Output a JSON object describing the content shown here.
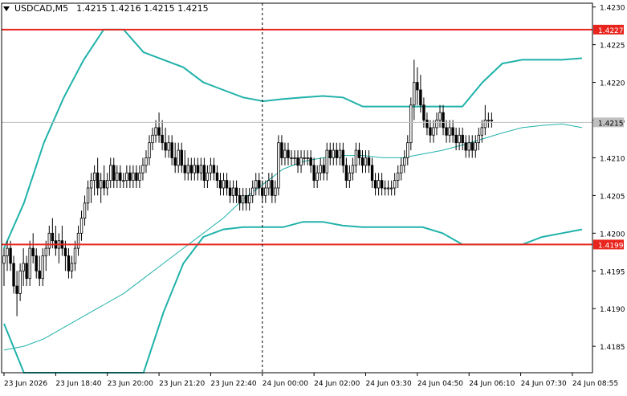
{
  "header": {
    "symbol": "USDCAD,M5",
    "ohlc": "1.4215 1.4216 1.4215 1.4215"
  },
  "colors": {
    "background": "#ffffff",
    "candle": "#000000",
    "bands": "#20b2aa",
    "ma": "#20b2aa",
    "level_line": "#e8241c",
    "current_price_bg": "#c0c0c0",
    "grid": "#000000"
  },
  "chart_data": {
    "type": "candlestick",
    "symbol": "USDCAD",
    "timeframe": "M5",
    "ylim": [
      1.41815,
      1.42305
    ],
    "y_ticks": [
      "1.4230",
      "1.4225",
      "1.4220",
      "1.4215",
      "1.4210",
      "1.4205",
      "1.4200",
      "1.4195",
      "1.4190",
      "1.4185"
    ],
    "y_tick_values": [
      1.423,
      1.4225,
      1.422,
      1.4215,
      1.421,
      1.4205,
      1.42,
      1.4195,
      1.419,
      1.4185
    ],
    "x_ticks": [
      "23 Jun 2026",
      "23 Jun 18:40",
      "23 Jun 20:00",
      "23 Jun 21:20",
      "23 Jun 22:40",
      "24 Jun 00:00",
      "24 Jun 02:00",
      "24 Jun 03:30",
      "24 Jun 04:50",
      "24 Jun 06:10",
      "24 Jun 07:30",
      "24 Jun 08:55"
    ],
    "x_tick_index": [
      0,
      16,
      32,
      48,
      64,
      80,
      96,
      112,
      128,
      144,
      160,
      176
    ],
    "period_separator_index": 80,
    "levels": [
      {
        "label": "1.4227",
        "value": 1.4227
      },
      {
        "label": "1.4199",
        "value": 1.41985
      }
    ],
    "current_price": {
      "label": "1.4215",
      "value": 1.42147
    },
    "grid": false,
    "candles": [
      [
        1.4196,
        1.4198,
        1.4193,
        1.4197
      ],
      [
        1.4197,
        1.4199,
        1.4195,
        1.4198
      ],
      [
        1.4198,
        1.4199,
        1.4195,
        1.4196
      ],
      [
        1.4196,
        1.4197,
        1.4192,
        1.4193
      ],
      [
        1.4193,
        1.4195,
        1.4189,
        1.4192
      ],
      [
        1.4192,
        1.4196,
        1.4191,
        1.4195
      ],
      [
        1.4195,
        1.4198,
        1.4193,
        1.4196
      ],
      [
        1.4196,
        1.4197,
        1.4193,
        1.4194
      ],
      [
        1.4194,
        1.4199,
        1.4193,
        1.4198
      ],
      [
        1.4198,
        1.42,
        1.4196,
        1.4197
      ],
      [
        1.4197,
        1.4198,
        1.4194,
        1.4195
      ],
      [
        1.4195,
        1.4197,
        1.4193,
        1.4194
      ],
      [
        1.4194,
        1.4198,
        1.4193,
        1.4197
      ],
      [
        1.4197,
        1.4199,
        1.4195,
        1.4198
      ],
      [
        1.4198,
        1.4201,
        1.4197,
        1.42
      ],
      [
        1.42,
        1.4202,
        1.4198,
        1.4199
      ],
      [
        1.4199,
        1.4201,
        1.4197,
        1.4198
      ],
      [
        1.4198,
        1.42,
        1.4196,
        1.4199
      ],
      [
        1.4199,
        1.4201,
        1.4197,
        1.4198
      ],
      [
        1.4198,
        1.4199,
        1.4195,
        1.4197
      ],
      [
        1.4197,
        1.4198,
        1.4194,
        1.4195
      ],
      [
        1.4195,
        1.4197,
        1.4194,
        1.4196
      ],
      [
        1.4196,
        1.4199,
        1.4195,
        1.4198
      ],
      [
        1.4198,
        1.4201,
        1.4197,
        1.42
      ],
      [
        1.42,
        1.4203,
        1.4199,
        1.4202
      ],
      [
        1.4202,
        1.4205,
        1.4201,
        1.4204
      ],
      [
        1.4204,
        1.4207,
        1.4203,
        1.4206
      ],
      [
        1.4206,
        1.4208,
        1.4204,
        1.4207
      ],
      [
        1.4207,
        1.4209,
        1.4205,
        1.4208
      ],
      [
        1.4208,
        1.421,
        1.4205,
        1.4206
      ],
      [
        1.4206,
        1.4208,
        1.4204,
        1.4207
      ],
      [
        1.4207,
        1.4209,
        1.4205,
        1.4206
      ],
      [
        1.4206,
        1.4208,
        1.4205,
        1.4207
      ],
      [
        1.4207,
        1.421,
        1.4206,
        1.4209
      ],
      [
        1.4209,
        1.421,
        1.4206,
        1.4207
      ],
      [
        1.4207,
        1.4209,
        1.4206,
        1.4208
      ],
      [
        1.4208,
        1.4209,
        1.4206,
        1.4207
      ],
      [
        1.4207,
        1.4208,
        1.4206,
        1.4207
      ],
      [
        1.4207,
        1.4209,
        1.4206,
        1.4208
      ],
      [
        1.4208,
        1.4209,
        1.4206,
        1.4207
      ],
      [
        1.4207,
        1.4209,
        1.4206,
        1.4208
      ],
      [
        1.4208,
        1.4209,
        1.4206,
        1.4207
      ],
      [
        1.4207,
        1.4209,
        1.4206,
        1.4208
      ],
      [
        1.4208,
        1.421,
        1.4207,
        1.4209
      ],
      [
        1.4209,
        1.4211,
        1.4208,
        1.421
      ],
      [
        1.421,
        1.4213,
        1.4209,
        1.4212
      ],
      [
        1.4212,
        1.4214,
        1.4211,
        1.4213
      ],
      [
        1.4213,
        1.4215,
        1.4212,
        1.4214
      ],
      [
        1.4214,
        1.4216,
        1.4212,
        1.4213
      ],
      [
        1.4213,
        1.4215,
        1.4211,
        1.4212
      ],
      [
        1.4212,
        1.4214,
        1.421,
        1.4211
      ],
      [
        1.4211,
        1.4213,
        1.421,
        1.4212
      ],
      [
        1.4212,
        1.4213,
        1.4209,
        1.421
      ],
      [
        1.421,
        1.4212,
        1.4208,
        1.4209
      ],
      [
        1.4209,
        1.4212,
        1.4208,
        1.4211
      ],
      [
        1.4211,
        1.4212,
        1.4208,
        1.4209
      ],
      [
        1.4209,
        1.4211,
        1.4207,
        1.4208
      ],
      [
        1.4208,
        1.421,
        1.4207,
        1.4209
      ],
      [
        1.4209,
        1.421,
        1.4207,
        1.4208
      ],
      [
        1.4208,
        1.421,
        1.4207,
        1.4209
      ],
      [
        1.4209,
        1.421,
        1.4207,
        1.4208
      ],
      [
        1.4208,
        1.421,
        1.4207,
        1.4209
      ],
      [
        1.4209,
        1.421,
        1.4206,
        1.4207
      ],
      [
        1.4207,
        1.4209,
        1.4206,
        1.4208
      ],
      [
        1.4208,
        1.421,
        1.4207,
        1.4209
      ],
      [
        1.4209,
        1.421,
        1.4207,
        1.4208
      ],
      [
        1.4208,
        1.4209,
        1.4206,
        1.4207
      ],
      [
        1.4207,
        1.4208,
        1.4205,
        1.4206
      ],
      [
        1.4206,
        1.4208,
        1.4205,
        1.4207
      ],
      [
        1.4207,
        1.4208,
        1.4205,
        1.4206
      ],
      [
        1.4206,
        1.4207,
        1.4204,
        1.4205
      ],
      [
        1.4205,
        1.4207,
        1.4204,
        1.4206
      ],
      [
        1.4206,
        1.4207,
        1.4204,
        1.4205
      ],
      [
        1.4205,
        1.4206,
        1.4203,
        1.4204
      ],
      [
        1.4204,
        1.4206,
        1.4203,
        1.4205
      ],
      [
        1.4205,
        1.4206,
        1.4203,
        1.4204
      ],
      [
        1.4204,
        1.4206,
        1.4203,
        1.4205
      ],
      [
        1.4205,
        1.4207,
        1.4204,
        1.4206
      ],
      [
        1.4206,
        1.4208,
        1.4205,
        1.4207
      ],
      [
        1.4207,
        1.4208,
        1.4205,
        1.4206
      ],
      [
        1.4206,
        1.4207,
        1.4204,
        1.4205
      ],
      [
        1.4205,
        1.4207,
        1.4204,
        1.4206
      ],
      [
        1.4206,
        1.4208,
        1.4205,
        1.4207
      ],
      [
        1.4207,
        1.4208,
        1.4204,
        1.4205
      ],
      [
        1.4205,
        1.4207,
        1.4204,
        1.4206
      ],
      [
        1.4206,
        1.4213,
        1.4205,
        1.4212
      ],
      [
        1.4212,
        1.4213,
        1.4209,
        1.421
      ],
      [
        1.421,
        1.4212,
        1.4209,
        1.4211
      ],
      [
        1.4211,
        1.4212,
        1.4209,
        1.421
      ],
      [
        1.421,
        1.4211,
        1.4209,
        1.421
      ],
      [
        1.421,
        1.4211,
        1.4209,
        1.421
      ],
      [
        1.421,
        1.4211,
        1.4208,
        1.4209
      ],
      [
        1.4209,
        1.4211,
        1.4208,
        1.421
      ],
      [
        1.421,
        1.4211,
        1.4209,
        1.421
      ],
      [
        1.421,
        1.4211,
        1.4209,
        1.421
      ],
      [
        1.421,
        1.4211,
        1.4208,
        1.4209
      ],
      [
        1.4209,
        1.421,
        1.4206,
        1.4207
      ],
      [
        1.4207,
        1.4209,
        1.4206,
        1.4208
      ],
      [
        1.4208,
        1.421,
        1.4207,
        1.4209
      ],
      [
        1.4209,
        1.421,
        1.4207,
        1.4208
      ],
      [
        1.4208,
        1.4212,
        1.4207,
        1.4211
      ],
      [
        1.4211,
        1.4212,
        1.4209,
        1.421
      ],
      [
        1.421,
        1.4212,
        1.4209,
        1.4211
      ],
      [
        1.4211,
        1.4212,
        1.4209,
        1.421
      ],
      [
        1.421,
        1.4212,
        1.4209,
        1.4211
      ],
      [
        1.4211,
        1.4212,
        1.4208,
        1.4209
      ],
      [
        1.4209,
        1.421,
        1.4206,
        1.4207
      ],
      [
        1.4207,
        1.4209,
        1.4206,
        1.4208
      ],
      [
        1.4208,
        1.421,
        1.4207,
        1.4209
      ],
      [
        1.4209,
        1.4212,
        1.4208,
        1.4211
      ],
      [
        1.4211,
        1.4212,
        1.4209,
        1.421
      ],
      [
        1.421,
        1.4211,
        1.4208,
        1.4209
      ],
      [
        1.4209,
        1.4211,
        1.4208,
        1.421
      ],
      [
        1.421,
        1.4211,
        1.4208,
        1.4209
      ],
      [
        1.4209,
        1.421,
        1.4206,
        1.4207
      ],
      [
        1.4207,
        1.4208,
        1.4205,
        1.4206
      ],
      [
        1.4206,
        1.4208,
        1.4205,
        1.4207
      ],
      [
        1.4207,
        1.4208,
        1.4205,
        1.4206
      ],
      [
        1.4206,
        1.4207,
        1.4205,
        1.4206
      ],
      [
        1.4206,
        1.4207,
        1.4205,
        1.4206
      ],
      [
        1.4206,
        1.4207,
        1.4205,
        1.4206
      ],
      [
        1.4206,
        1.4208,
        1.4205,
        1.4207
      ],
      [
        1.4207,
        1.4209,
        1.4206,
        1.4208
      ],
      [
        1.4208,
        1.421,
        1.4207,
        1.4209
      ],
      [
        1.4209,
        1.4211,
        1.4208,
        1.421
      ],
      [
        1.421,
        1.4213,
        1.4209,
        1.4212
      ],
      [
        1.4212,
        1.4218,
        1.4211,
        1.4217
      ],
      [
        1.4217,
        1.4223,
        1.4215,
        1.422
      ],
      [
        1.422,
        1.4222,
        1.4217,
        1.4219
      ],
      [
        1.4219,
        1.4221,
        1.4216,
        1.4217
      ],
      [
        1.4217,
        1.4218,
        1.4214,
        1.4215
      ],
      [
        1.4215,
        1.4216,
        1.4213,
        1.4214
      ],
      [
        1.4214,
        1.4215,
        1.4212,
        1.4213
      ],
      [
        1.4213,
        1.4215,
        1.4212,
        1.4214
      ],
      [
        1.4214,
        1.4216,
        1.4213,
        1.4215
      ],
      [
        1.4215,
        1.4217,
        1.4214,
        1.4216
      ],
      [
        1.4216,
        1.4217,
        1.4213,
        1.4214
      ],
      [
        1.4214,
        1.4215,
        1.4212,
        1.4213
      ],
      [
        1.4213,
        1.4215,
        1.4212,
        1.4214
      ],
      [
        1.4214,
        1.4215,
        1.4212,
        1.4213
      ],
      [
        1.4213,
        1.4214,
        1.4211,
        1.4212
      ],
      [
        1.4212,
        1.4214,
        1.4211,
        1.4213
      ],
      [
        1.4213,
        1.4214,
        1.4211,
        1.4212
      ],
      [
        1.4212,
        1.4213,
        1.421,
        1.4211
      ],
      [
        1.4211,
        1.4213,
        1.421,
        1.4212
      ],
      [
        1.4212,
        1.4213,
        1.421,
        1.4211
      ],
      [
        1.4211,
        1.4213,
        1.421,
        1.4212
      ],
      [
        1.4212,
        1.4214,
        1.4211,
        1.4213
      ],
      [
        1.4213,
        1.4215,
        1.4212,
        1.4214
      ],
      [
        1.4214,
        1.4217,
        1.4213,
        1.4215
      ],
      [
        1.4215,
        1.4216,
        1.4214,
        1.4215
      ],
      [
        1.4215,
        1.4216,
        1.4214,
        1.4215
      ]
    ],
    "series": [
      {
        "name": "",
        "values": [
          1.41845,
          1.4185,
          1.4186,
          1.41875,
          1.4189,
          1.41905,
          1.4192,
          1.4194,
          1.4196,
          1.4198,
          1.42,
          1.4202,
          1.42045,
          1.42065,
          1.42085,
          1.42095,
          1.421,
          1.42103,
          1.42103,
          1.421,
          1.421,
          1.42105,
          1.4211,
          1.42117,
          1.42125,
          1.42133,
          1.4214,
          1.42143,
          1.42145,
          1.4214
        ]
      },
      {
        "name": "",
        "values": [
          1.4198,
          1.4204,
          1.4212,
          1.4218,
          1.4223,
          1.4227,
          1.4227,
          1.4224,
          1.4223,
          1.4222,
          1.422,
          1.4219,
          1.4218,
          1.42175,
          1.42178,
          1.4218,
          1.42182,
          1.4218,
          1.42168,
          1.42168,
          1.42168,
          1.42168,
          1.42168,
          1.42168,
          1.422,
          1.42225,
          1.4223,
          1.4223,
          1.4223,
          1.42232
        ]
      },
      {
        "name": "",
        "values": [
          1.4188,
          1.4179,
          1.4175,
          1.4172,
          1.41672,
          1.4166,
          1.41695,
          1.41805,
          1.41895,
          1.4196,
          1.41995,
          1.42005,
          1.42008,
          1.42008,
          1.42008,
          1.42015,
          1.42015,
          1.4201,
          1.42008,
          1.42008,
          1.42008,
          1.42008,
          1.42,
          1.41985,
          1.41985,
          1.41985,
          1.41985,
          1.41995,
          1.42,
          1.42005
        ]
      }
    ]
  }
}
